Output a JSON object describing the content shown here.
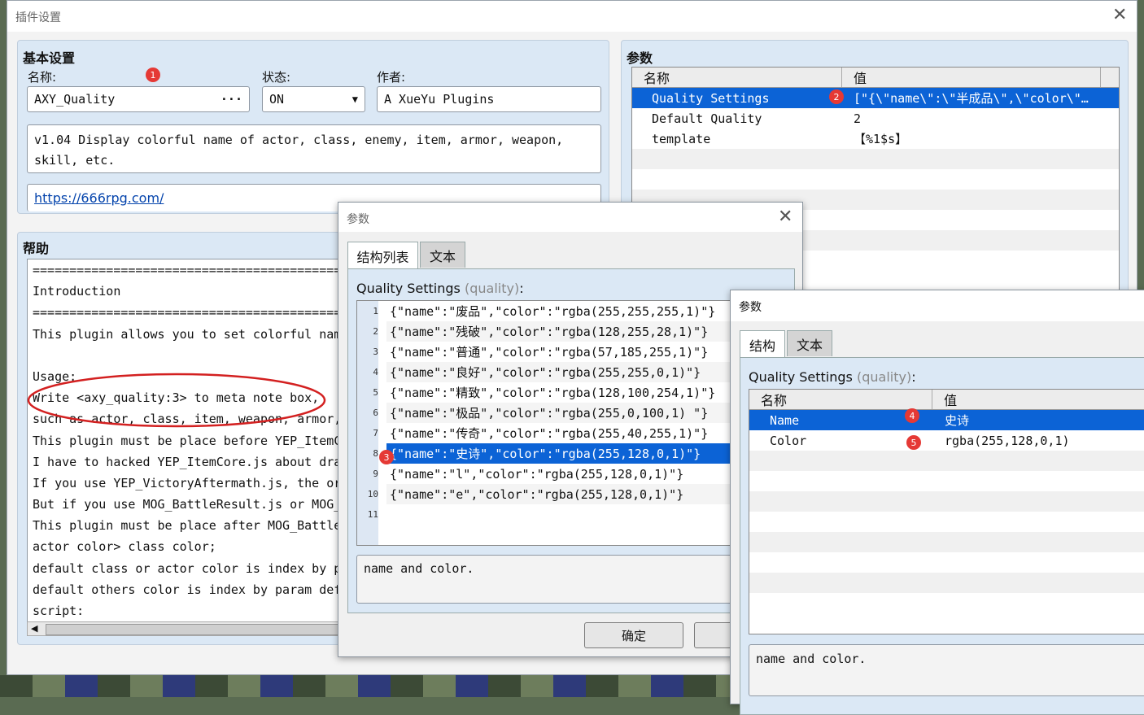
{
  "main_window": {
    "title": "插件设置",
    "basic": {
      "heading": "基本设置",
      "name_label": "名称:",
      "name_value": "AXY_Quality",
      "name_button": "···",
      "status_label": "状态:",
      "status_value": "ON",
      "author_label": "作者:",
      "author_value": "A XueYu Plugins",
      "description": "v1.04 Display colorful name of actor, class, enemy, item, armor, weapon, skill, etc.",
      "url": "https://666rpg.com/"
    },
    "params": {
      "heading": "参数",
      "col_name": "名称",
      "col_value": "值",
      "rows": [
        {
          "name": "Quality Settings",
          "value": "[\"{\\\"name\\\":\\\"半成品\\\",\\\"color\\\"…"
        },
        {
          "name": "Default Quality",
          "value": "2"
        },
        {
          "name": "template",
          "value": "【%1$s】"
        }
      ]
    },
    "help": {
      "heading": "帮助",
      "lines": [
        "===========================================",
        "Introduction",
        "===========================================",
        "This plugin allows you to set colorful name",
        "",
        "Usage:",
        "Write <axy_quality:3> to meta note box,",
        "such as actor, class, item, weapon, armor,",
        "This plugin must be place before YEP_ItemCo",
        "I have to hacked YEP_ItemCore.js about draw",
        "If you use YEP_VictoryAftermath.js, the ord",
        "But if you use MOG_BattleResult.js or MOG_T",
        "This plugin must be place after MOG_BattleR",
        "actor color> class color;",
        "default class or actor color is index by pa",
        "default others color is index by param defa",
        "script:"
      ]
    }
  },
  "dialog1": {
    "title": "参数",
    "tab_list": "结构列表",
    "tab_text": "文本",
    "label": "Quality Settings",
    "label_key": "(quality)",
    "label_colon": ":",
    "lines": [
      {
        "n": "1",
        "text": "{\"name\":\"废品\",\"color\":\"rgba(255,255,255,1)\"}"
      },
      {
        "n": "2",
        "text": "{\"name\":\"残破\",\"color\":\"rgba(128,255,28,1)\"}"
      },
      {
        "n": "3",
        "text": "{\"name\":\"普通\",\"color\":\"rgba(57,185,255,1)\"}"
      },
      {
        "n": "4",
        "text": "{\"name\":\"良好\",\"color\":\"rgba(255,255,0,1)\"}"
      },
      {
        "n": "5",
        "text": "{\"name\":\"精致\",\"color\":\"rgba(128,100,254,1)\"}"
      },
      {
        "n": "6",
        "text": "{\"name\":\"极品\",\"color\":\"rgba(255,0,100,1) \"}"
      },
      {
        "n": "7",
        "text": "{\"name\":\"传奇\",\"color\":\"rgba(255,40,255,1)\"}"
      },
      {
        "n": "8",
        "text": "{\"name\":\"史诗\",\"color\":\"rgba(255,128,0,1)\"}"
      },
      {
        "n": "9",
        "text": "{\"name\":\"l\",\"color\":\"rgba(255,128,0,1)\"}"
      },
      {
        "n": "10",
        "text": "{\"name\":\"e\",\"color\":\"rgba(255,128,0,1)\"}"
      },
      {
        "n": "11",
        "text": ""
      }
    ],
    "description": "name and color.",
    "ok_button": "确定"
  },
  "dialog2": {
    "title": "参数",
    "tab_struct": "结构",
    "tab_text": "文本",
    "label": "Quality Settings",
    "label_key": "(quality)",
    "label_colon": ":",
    "col_name": "名称",
    "col_value": "值",
    "rows": [
      {
        "name": "Name",
        "value": "史诗"
      },
      {
        "name": "Color",
        "value": "rgba(255,128,0,1)"
      }
    ],
    "description": "name and color."
  },
  "badges": [
    "1",
    "2",
    "3",
    "4",
    "5"
  ],
  "colors": {
    "selection": "#0c63d6",
    "panel": "#dbe8f5",
    "badge": "#e53935",
    "annotation_ellipse": "#d32020",
    "link": "#0645ad"
  }
}
